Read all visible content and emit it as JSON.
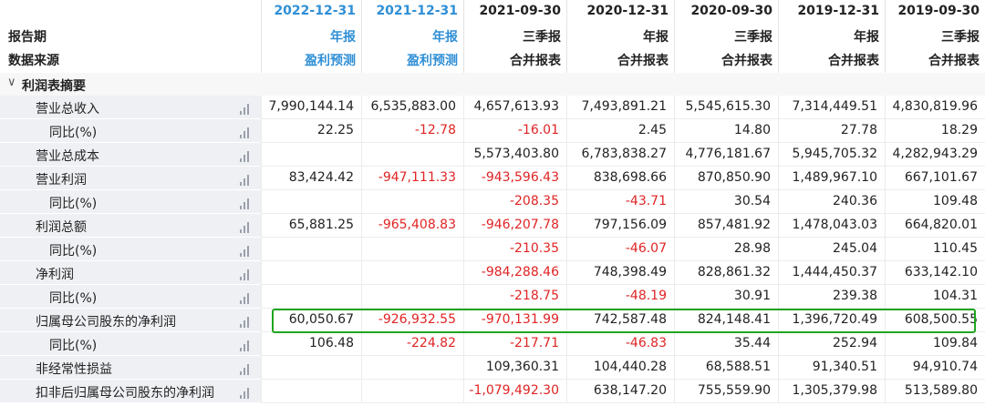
{
  "header": {
    "labels": [
      "报告期",
      "数据来源"
    ],
    "columns": [
      {
        "date": "2022-12-31",
        "type": "年报",
        "source": "盈利预测",
        "forecast": true
      },
      {
        "date": "2021-12-31",
        "type": "年报",
        "source": "盈利预测",
        "forecast": true
      },
      {
        "date": "2021-09-30",
        "type": "三季报",
        "source": "合并报表",
        "forecast": false
      },
      {
        "date": "2020-12-31",
        "type": "年报",
        "source": "合并报表",
        "forecast": false
      },
      {
        "date": "2020-09-30",
        "type": "三季报",
        "source": "合并报表",
        "forecast": false
      },
      {
        "date": "2019-12-31",
        "type": "年报",
        "source": "合并报表",
        "forecast": false
      },
      {
        "date": "2019-09-30",
        "type": "三季报",
        "source": "合并报表",
        "forecast": false
      }
    ]
  },
  "section": {
    "title": "利润表摘要",
    "chevron_icon": "chevron-down-icon"
  },
  "rows": [
    {
      "label": "营业总收入",
      "indent": false,
      "values": [
        "7,990,144.14",
        "6,535,883.00",
        "4,657,613.93",
        "7,493,891.21",
        "5,545,615.30",
        "7,314,449.51",
        "4,830,819.96"
      ]
    },
    {
      "label": "同比(%)",
      "indent": true,
      "values": [
        "22.25",
        "-12.78",
        "-16.01",
        "2.45",
        "14.80",
        "27.78",
        "18.29"
      ]
    },
    {
      "label": "营业总成本",
      "indent": false,
      "values": [
        "",
        "",
        "5,573,403.80",
        "6,783,838.27",
        "4,776,181.67",
        "5,945,705.32",
        "4,282,943.29"
      ]
    },
    {
      "label": "营业利润",
      "indent": false,
      "values": [
        "83,424.42",
        "-947,111.33",
        "-943,596.43",
        "838,698.66",
        "870,850.90",
        "1,489,967.10",
        "667,101.67"
      ]
    },
    {
      "label": "同比(%)",
      "indent": true,
      "values": [
        "",
        "",
        "-208.35",
        "-43.71",
        "30.54",
        "240.36",
        "109.48"
      ]
    },
    {
      "label": "利润总额",
      "indent": false,
      "values": [
        "65,881.25",
        "-965,408.83",
        "-946,207.78",
        "797,156.09",
        "857,481.92",
        "1,478,043.03",
        "664,820.01"
      ]
    },
    {
      "label": "同比(%)",
      "indent": true,
      "values": [
        "",
        "",
        "-210.35",
        "-46.07",
        "28.98",
        "245.04",
        "110.45"
      ]
    },
    {
      "label": "净利润",
      "indent": false,
      "values": [
        "",
        "",
        "-984,288.46",
        "748,398.49",
        "828,861.32",
        "1,444,450.37",
        "633,142.10"
      ]
    },
    {
      "label": "同比(%)",
      "indent": true,
      "values": [
        "",
        "",
        "-218.75",
        "-48.19",
        "30.91",
        "239.38",
        "104.31"
      ]
    },
    {
      "label": "归属母公司股东的净利润",
      "indent": false,
      "highlight": true,
      "values": [
        "60,050.67",
        "-926,932.55",
        "-970,131.99",
        "742,587.48",
        "824,148.41",
        "1,396,720.49",
        "608,500.55"
      ]
    },
    {
      "label": "同比(%)",
      "indent": true,
      "values": [
        "106.48",
        "-224.82",
        "-217.71",
        "-46.83",
        "35.44",
        "252.94",
        "109.84"
      ]
    },
    {
      "label": "非经常性损益",
      "indent": false,
      "values": [
        "",
        "",
        "109,360.31",
        "104,440.28",
        "68,588.51",
        "91,340.51",
        "94,910.74"
      ]
    },
    {
      "label": "扣非后归属母公司股东的净利润",
      "indent": false,
      "values": [
        "",
        "",
        "-1,079,492.30",
        "638,147.20",
        "755,559.90",
        "1,305,379.98",
        "513,589.80"
      ]
    }
  ],
  "colors": {
    "positive": "#222222",
    "negative": "#e02424",
    "header_blue": "#2f8fd6",
    "highlight": "#1fa51f",
    "label_bg": "#eef0f3"
  },
  "row_icon": "bar-chart-icon"
}
